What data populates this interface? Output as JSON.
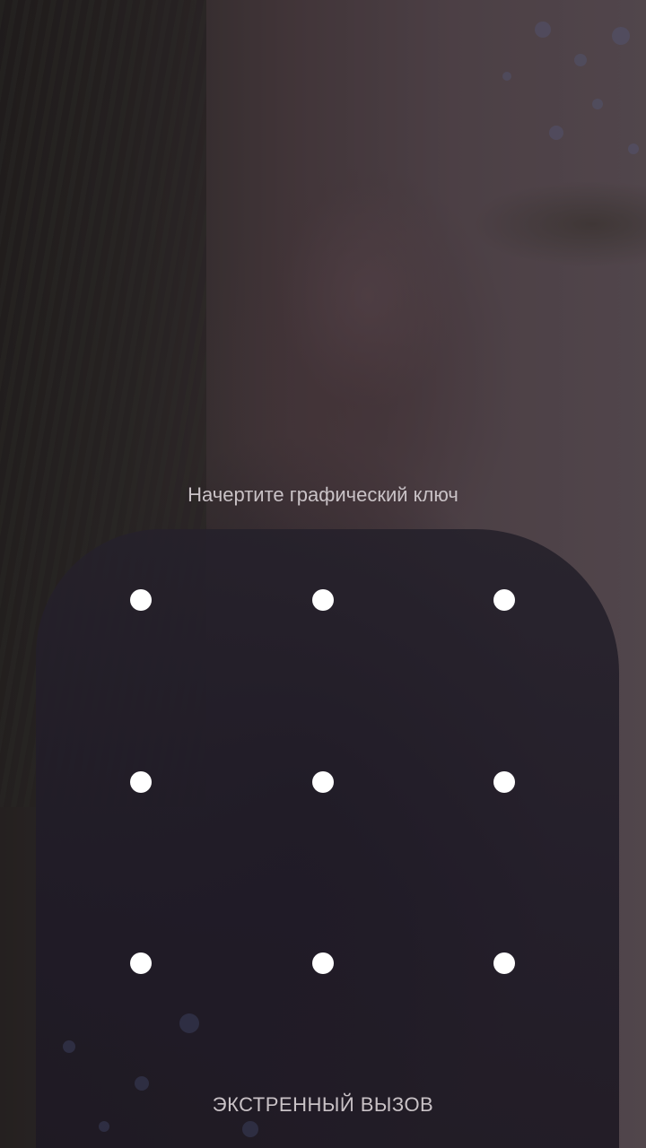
{
  "lock_screen": {
    "prompt_text": "Начертите графический ключ",
    "emergency_call_label": "ЭКСТРЕННЫЙ ВЫЗОВ"
  },
  "pattern_grid": {
    "rows": 3,
    "columns": 3,
    "dot_color": "#ffffff"
  },
  "colors": {
    "text": "#c9c2c6"
  }
}
